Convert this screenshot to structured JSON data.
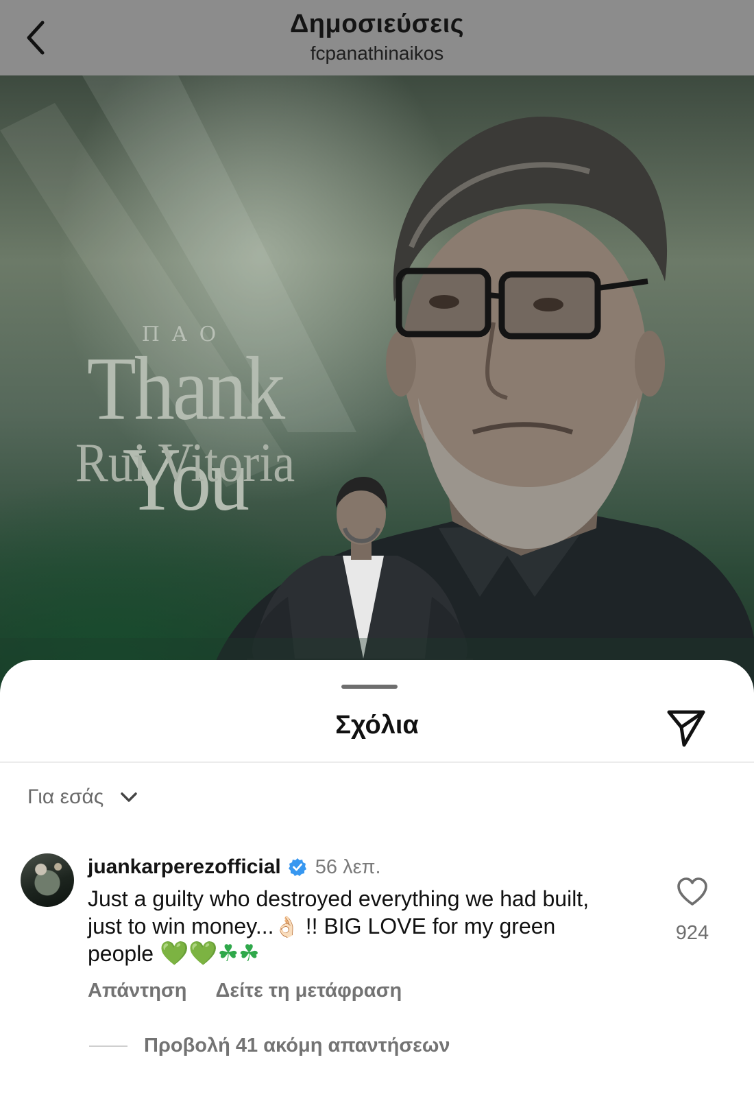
{
  "header": {
    "title": "Δημοσιεύσεις",
    "username": "fcpanathinaikos",
    "back_icon": "chevron-left-icon"
  },
  "post": {
    "graphic": {
      "club_mark": "ΠΑΟ",
      "headline": "Thank You",
      "name": "Rui Vitoria"
    },
    "colors": {
      "background": "#3d4a3f",
      "headline": "#b4bcb1"
    }
  },
  "comments_sheet": {
    "title": "Σχόλια",
    "share_icon": "paper-plane-icon",
    "filter": {
      "label": "Για εσάς",
      "icon": "chevron-down-icon"
    },
    "comments": [
      {
        "username": "juankarperezofficial",
        "verified": true,
        "time": "56 λεπ.",
        "text_part1": "Just a guilty who destroyed everything we had built, just to win money...",
        "text_part2": " !! BIG LOVE for my green people ",
        "emoji_ok": "👌🏻",
        "emoji_hearts": [
          "💚",
          "💚"
        ],
        "emoji_clovers": [
          "☘",
          "☘"
        ],
        "actions": {
          "reply": "Απάντηση",
          "translate": "Δείτε τη μετάφραση"
        },
        "likes": "924",
        "view_more": "Προβολή 41 ακόμη απαντήσεων"
      }
    ],
    "colors": {
      "verified_badge": "#3797f0",
      "secondary_text": "#737373"
    }
  }
}
